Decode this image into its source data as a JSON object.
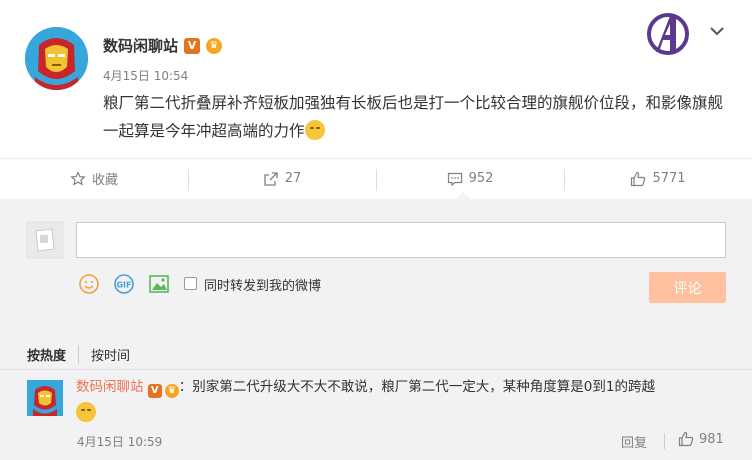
{
  "post": {
    "author": "数码闲聊站",
    "verified_badge": "V",
    "time": "4月15日 10:54",
    "text": "粮厂第二代折叠屏补齐短板加强独有长板后也是打一个比较合理的旗舰价位段，和影像旗舰一起算是今年冲超高端的力作",
    "emoji": "smile-emoji"
  },
  "actions": {
    "favorite": "收藏",
    "repost_count": "27",
    "comment_count": "952",
    "like_count": "5771"
  },
  "composer": {
    "input_value": "",
    "repost_label": "同时转发到我的微博",
    "submit_label": "评论",
    "tools": [
      "smile-icon",
      "gif-icon",
      "image-icon"
    ]
  },
  "sort": {
    "hot": "按热度",
    "time": "按时间"
  },
  "comments": [
    {
      "author": "数码闲聊站",
      "verified_badge": "V",
      "text": "：别家第二代升级大不大不敢说，粮厂第二代一定大，某种角度算是0到1的跨越",
      "time": "4月15日 10:59",
      "reply_label": "回复",
      "like_count": "981"
    }
  ],
  "colors": {
    "accent_orange": "#eb7350",
    "submit_disabled": "#ffc09f",
    "panel_bg": "#f2f2f5",
    "muted_text": "#808080"
  }
}
